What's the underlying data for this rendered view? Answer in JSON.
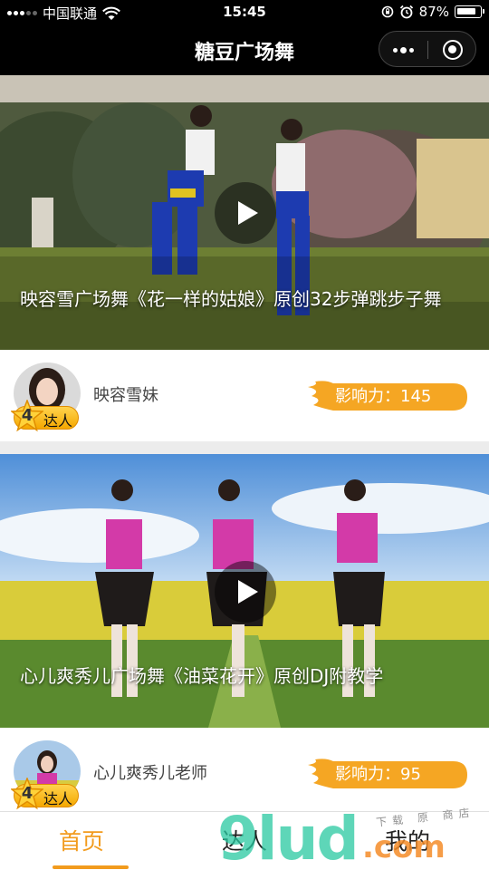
{
  "status_bar": {
    "carrier": "中国联通",
    "time": "15:45",
    "battery_text": "87%",
    "battery_level": 0.87,
    "signal_level": 3
  },
  "nav": {
    "title": "糖豆广场舞",
    "more_icon": "more-dots-icon",
    "close_icon": "miniprogram-close-icon"
  },
  "feed": [
    {
      "title": "映容雪广场舞《花一样的姑娘》原创32步弹跳步子舞",
      "author": "映容雪妹",
      "level": "4",
      "badge": "达人",
      "influence": "影响力：145"
    },
    {
      "title": "心儿爽秀儿广场舞《油菜花开》原创DJ附教学",
      "author": "心儿爽秀儿老师",
      "level": "4",
      "badge": "达人",
      "influence": "影响力：95"
    }
  ],
  "tabbar": {
    "tabs": [
      {
        "label": "首页",
        "active": true
      },
      {
        "label": "达人",
        "active": false
      },
      {
        "label": "我的",
        "active": false
      }
    ]
  },
  "watermark": {
    "big": "9lud",
    "com": ".com",
    "small": "下载 原 商店"
  },
  "colors": {
    "accent": "#f29b1d",
    "influence_bg": "#f5a623",
    "badge": "#f5b400"
  }
}
